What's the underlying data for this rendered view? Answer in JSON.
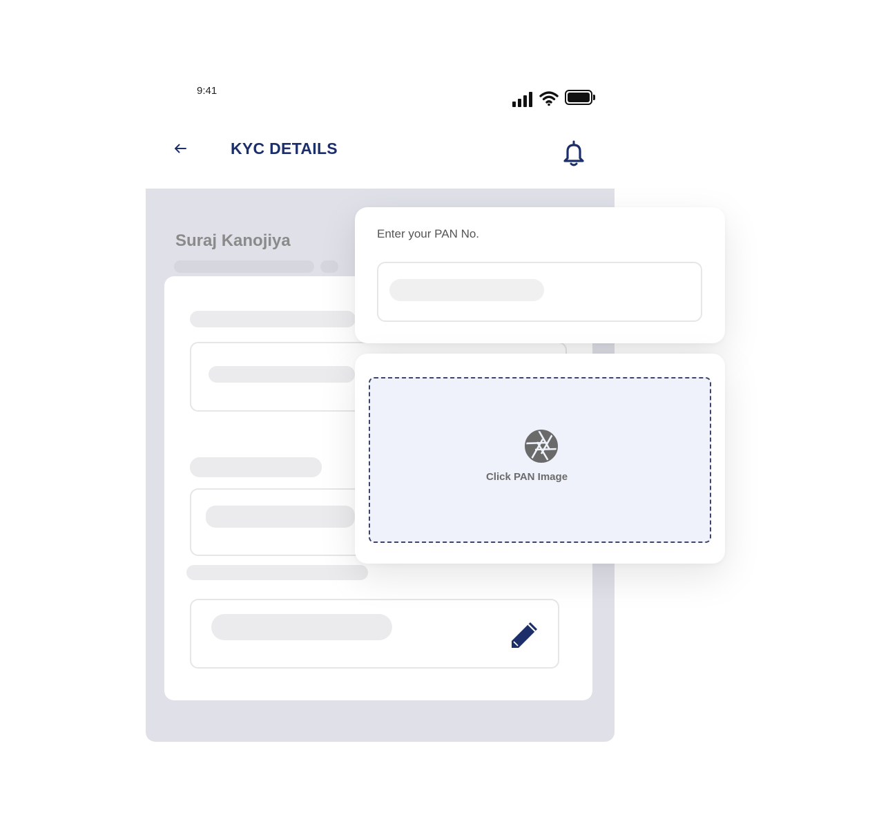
{
  "status_bar": {
    "time": "9:41"
  },
  "header": {
    "title": "KYC DETAILS",
    "back_icon": "arrow-left-icon",
    "notification_icon": "bell-icon"
  },
  "profile": {
    "name": "Suraj Kanojiya"
  },
  "pan_card": {
    "label": "Enter your PAN No.",
    "input_value": ""
  },
  "upload": {
    "label": "Click PAN Image",
    "icon": "camera-shutter-icon"
  },
  "colors": {
    "primary": "#1c2f6b",
    "background_panel": "#dfe0e8",
    "upload_bg": "#eff2fa"
  }
}
